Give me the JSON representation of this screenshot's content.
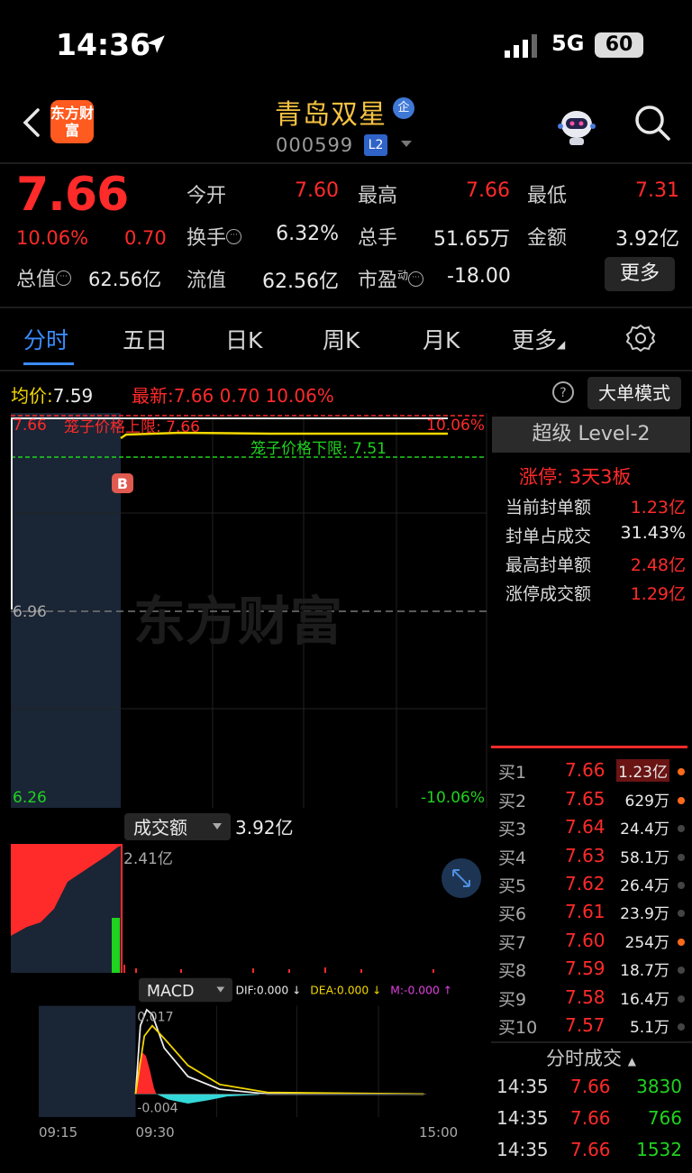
{
  "status_bar": {
    "time": "14:36",
    "network": "5G",
    "battery": "60"
  },
  "header": {
    "logo_text": "东方财富",
    "stock_name": "青岛双星",
    "name_badge": "企",
    "stock_code": "000599",
    "level_badge": "L2"
  },
  "quote": {
    "price": "7.66",
    "pct_change": "10.06%",
    "change": "0.70",
    "mktcap_label": "总值",
    "mktcap_value": "62.56亿",
    "fields": [
      {
        "label": "今开",
        "value": "7.60",
        "color": "#ff2a2a"
      },
      {
        "label": "最高",
        "value": "7.66",
        "color": "#ff2a2a"
      },
      {
        "label": "最低",
        "value": "7.31",
        "color": "#ff2a2a"
      },
      {
        "label": "换手",
        "value": "6.32%",
        "color": "#eaeaea"
      },
      {
        "label": "总手",
        "value": "51.65万",
        "color": "#eaeaea"
      },
      {
        "label": "金额",
        "value": "3.92亿",
        "color": "#eaeaea"
      },
      {
        "label": "流值",
        "value": "62.56亿",
        "color": "#eaeaea"
      },
      {
        "label": "市盈",
        "value": "-18.00",
        "color": "#eaeaea",
        "superscript": "动"
      }
    ],
    "more_label": "更多"
  },
  "tabs": [
    "分时",
    "五日",
    "日K",
    "周K",
    "月K",
    "更多"
  ],
  "price_line": {
    "avg_label": "均价:",
    "avg_value": "7.59",
    "latest_label": "最新:",
    "latest_value": "7.66",
    "latest_change": "0.70",
    "latest_pct": "10.06%",
    "big_order_label": "大单模式"
  },
  "chart_labels": {
    "y_top": "7.66",
    "y_mid": "6.96",
    "y_bottom": "6.26",
    "pct_top": "10.06%",
    "pct_bottom": "-10.06%",
    "upper_limit": "笼子价格上限: 7.66",
    "lower_limit": "笼子价格下限: 7.51",
    "marker": "B",
    "watermark": "东方财富",
    "volume_selector": "成交额",
    "volume_total": "3.92亿",
    "volume_max": "2.41亿",
    "macd_selector": "MACD",
    "dif": "DIF:0.000 ↓",
    "dea": "DEA:0.000 ↓",
    "m": "M:-0.000 ↑",
    "macd_top": "0.017",
    "macd_bottom": "-0.004",
    "times": [
      "09:15",
      "09:30",
      "15:00"
    ]
  },
  "level2": {
    "title": "超级 Level-2",
    "limit_title": "涨停: 3天3板",
    "rows": [
      {
        "label": "当前封单额",
        "value": "1.23亿",
        "color": "#ff2a2a"
      },
      {
        "label": "封单占成交",
        "value": "31.43%",
        "color": "#eaeaea"
      },
      {
        "label": "最高封单额",
        "value": "2.48亿",
        "color": "#ff2a2a"
      },
      {
        "label": "涨停成交额",
        "value": "1.29亿",
        "color": "#ff2a2a"
      }
    ]
  },
  "bids": [
    {
      "label": "买1",
      "price": "7.66",
      "qty": "1.23亿",
      "dot": "#ff6a1a"
    },
    {
      "label": "买2",
      "price": "7.65",
      "qty": "629万",
      "dot": "#ff6a1a"
    },
    {
      "label": "买3",
      "price": "7.64",
      "qty": "24.4万",
      "dot": "#444"
    },
    {
      "label": "买4",
      "price": "7.63",
      "qty": "58.1万",
      "dot": "#444"
    },
    {
      "label": "买5",
      "price": "7.62",
      "qty": "26.4万",
      "dot": "#444"
    },
    {
      "label": "买6",
      "price": "7.61",
      "qty": "23.9万",
      "dot": "#444"
    },
    {
      "label": "买7",
      "price": "7.60",
      "qty": "254万",
      "dot": "#ff6a1a"
    },
    {
      "label": "买8",
      "price": "7.59",
      "qty": "18.7万",
      "dot": "#444"
    },
    {
      "label": "买9",
      "price": "7.58",
      "qty": "16.4万",
      "dot": "#444"
    },
    {
      "label": "买10",
      "price": "7.57",
      "qty": "5.1万",
      "dot": "#444"
    }
  ],
  "trades_title": "分时成交",
  "trades": [
    {
      "time": "14:35",
      "price": "7.66",
      "vol": "3830"
    },
    {
      "time": "14:35",
      "price": "7.66",
      "vol": "766"
    },
    {
      "time": "14:35",
      "price": "7.66",
      "vol": "1532"
    }
  ]
}
